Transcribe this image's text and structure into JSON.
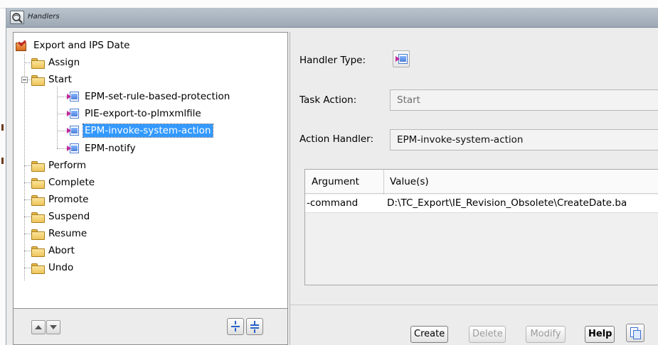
{
  "window": {
    "title": "Handlers",
    "title_icon": "handlers-window-icon"
  },
  "tree": {
    "root": {
      "label": "Export and IPS Date",
      "icon": "task-template-icon"
    },
    "items": [
      {
        "label": "Assign",
        "icon": "folder-icon"
      },
      {
        "label": "Start",
        "icon": "folder-open-icon",
        "expanded": true
      },
      {
        "label": "EPM-set-rule-based-protection",
        "icon": "handler-icon"
      },
      {
        "label": "PIE-export-to-plmxmlfile",
        "icon": "handler-icon"
      },
      {
        "label": "EPM-invoke-system-action",
        "icon": "handler-icon",
        "selected": true
      },
      {
        "label": "EPM-notify",
        "icon": "handler-icon"
      },
      {
        "label": "Perform",
        "icon": "folder-icon"
      },
      {
        "label": "Complete",
        "icon": "folder-icon"
      },
      {
        "label": "Promote",
        "icon": "folder-icon"
      },
      {
        "label": "Suspend",
        "icon": "folder-icon"
      },
      {
        "label": "Resume",
        "icon": "folder-icon"
      },
      {
        "label": "Abort",
        "icon": "folder-icon"
      },
      {
        "label": "Undo",
        "icon": "folder-icon"
      }
    ],
    "footer": {
      "move_up_icon": "move-up-icon",
      "move_down_icon": "move-down-icon",
      "expand_icon": "expand-all-icon",
      "collapse_icon": "collapse-all-icon"
    }
  },
  "details": {
    "handler_type_label": "Handler Type:",
    "handler_type_icon": "action-handler-icon",
    "task_action_label": "Task Action:",
    "task_action_value": "Start",
    "action_handler_label": "Action Handler:",
    "action_handler_value": "EPM-invoke-system-action",
    "arguments": {
      "columns": [
        "Argument",
        "Value(s)"
      ],
      "rows": [
        {
          "argument": "-command",
          "value": "D:\\TC_Export\\IE_Revision_Obsolete\\CreateDate.ba"
        }
      ]
    }
  },
  "actions": {
    "create": "Create",
    "delete": "Delete",
    "modify": "Modify",
    "help": "Help",
    "copy_icon": "copy-icon"
  },
  "colors": {
    "selection": "#3399ff",
    "titlebar": "#a9b4bf",
    "window_bg": "#ececec"
  }
}
